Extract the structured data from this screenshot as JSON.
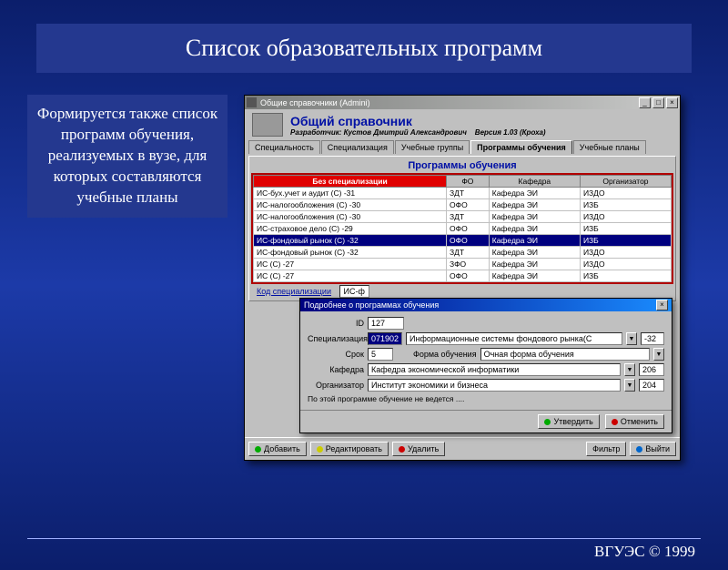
{
  "slide": {
    "title": "Список образовательных программ",
    "left_text": "Формируется также список программ обучения, реализуемых в вузе, для которых составляются учебные планы",
    "footer": "ВГУЭС © 1999"
  },
  "window": {
    "title": "Общие справочники (Admini)",
    "header_title": "Общий справочник",
    "developer_label": "Разработчик:",
    "developer_name": "Кустов Дмитрий Александрович",
    "version_label": "Версия 1.03 (Кроха)",
    "tabs": [
      "Специальность",
      "Специализация",
      "Учебные группы",
      "Программы обучения",
      "Учебные планы"
    ],
    "active_tab": 3,
    "panel_title": "Программы обучения",
    "columns": [
      "Без специализации",
      "ФО",
      "Кафедра",
      "Организатор"
    ],
    "rows": [
      [
        "ИС-бух.учет и аудит (С) -31",
        "ЗДТ",
        "Кафедра ЭИ",
        "ИЗДО"
      ],
      [
        "ИС-налогообложения (С) -30",
        "ОФО",
        "Кафедра ЭИ",
        "ИЗБ"
      ],
      [
        "ИС-налогообложения (С) -30",
        "ЗДТ",
        "Кафедра ЭИ",
        "ИЗДО"
      ],
      [
        "ИС-страховое дело (С) -29",
        "ОФО",
        "Кафедра ЭИ",
        "ИЗБ"
      ],
      [
        "ИС-фондовый рынок (С) -32",
        "ОФО",
        "Кафедра ЭИ",
        "ИЗБ"
      ],
      [
        "ИС-фондовый рынок (С) -32",
        "ЗДТ",
        "Кафедра ЭИ",
        "ИЗДО"
      ],
      [
        "ИС (С) -27",
        "ЗФО",
        "Кафедра ЭИ",
        "ИЗДО"
      ],
      [
        "ИС (С) -27",
        "ОФО",
        "Кафедра ЭИ",
        "ИЗБ"
      ]
    ],
    "selected_row": 4,
    "code_label": "Код специализации",
    "code_value": "ИС-ф",
    "bottom_buttons": [
      "Добавить",
      "Редактировать",
      "Удалить",
      "Фильтр",
      "Выйти"
    ]
  },
  "dialog": {
    "title": "Подробнее о программах обучения",
    "id_label": "ID",
    "id_value": "127",
    "spec_label": "Специализация",
    "spec_code": "071902",
    "spec_name": "Информационные системы фондового рынка(С",
    "spec_num": "-32",
    "term_label": "Срок",
    "term_value": "5",
    "form_label": "Форма обучения",
    "form_value": "Очная форма обучения",
    "dept_label": "Кафедра",
    "dept_value": "Кафедра экономической информатики",
    "dept_code": "206",
    "org_label": "Организатор",
    "org_value": "Институт экономики и бизнеса",
    "org_code": "204",
    "note": "По этой программе обучение  не ведется ....",
    "ok": "Утвердить",
    "cancel": "Отменить"
  }
}
